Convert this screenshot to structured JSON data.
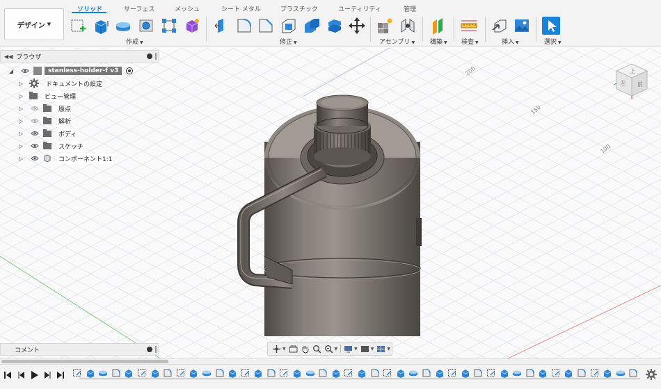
{
  "toolbar": {
    "workspace": "デザイン",
    "tabs": [
      "ソリッド",
      "サーフェス",
      "メッシュ",
      "シート メタル",
      "プラスチック",
      "ユーティリティ",
      "管理"
    ],
    "groups": [
      "作成",
      "修正",
      "アセンブリ",
      "構築",
      "検査",
      "挿入",
      "選択"
    ]
  },
  "browser": {
    "title": "ブラウザ",
    "root": "stanless-holder-f v3",
    "items": [
      "ドキュメントの設定",
      "ビュー管理",
      "原点",
      "解析",
      "ボディ",
      "スケッチ",
      "コンポーネント1:1"
    ]
  },
  "viewport": {
    "axis_labels": [
      "200",
      "150",
      "100"
    ],
    "viewcube": {
      "top": "上",
      "front": "前",
      "left": "左"
    }
  },
  "comments": {
    "title": "コメント"
  },
  "colors": {
    "accent": "#0a84d6",
    "body": "#6f6a63",
    "grid": "#d9dde2"
  }
}
